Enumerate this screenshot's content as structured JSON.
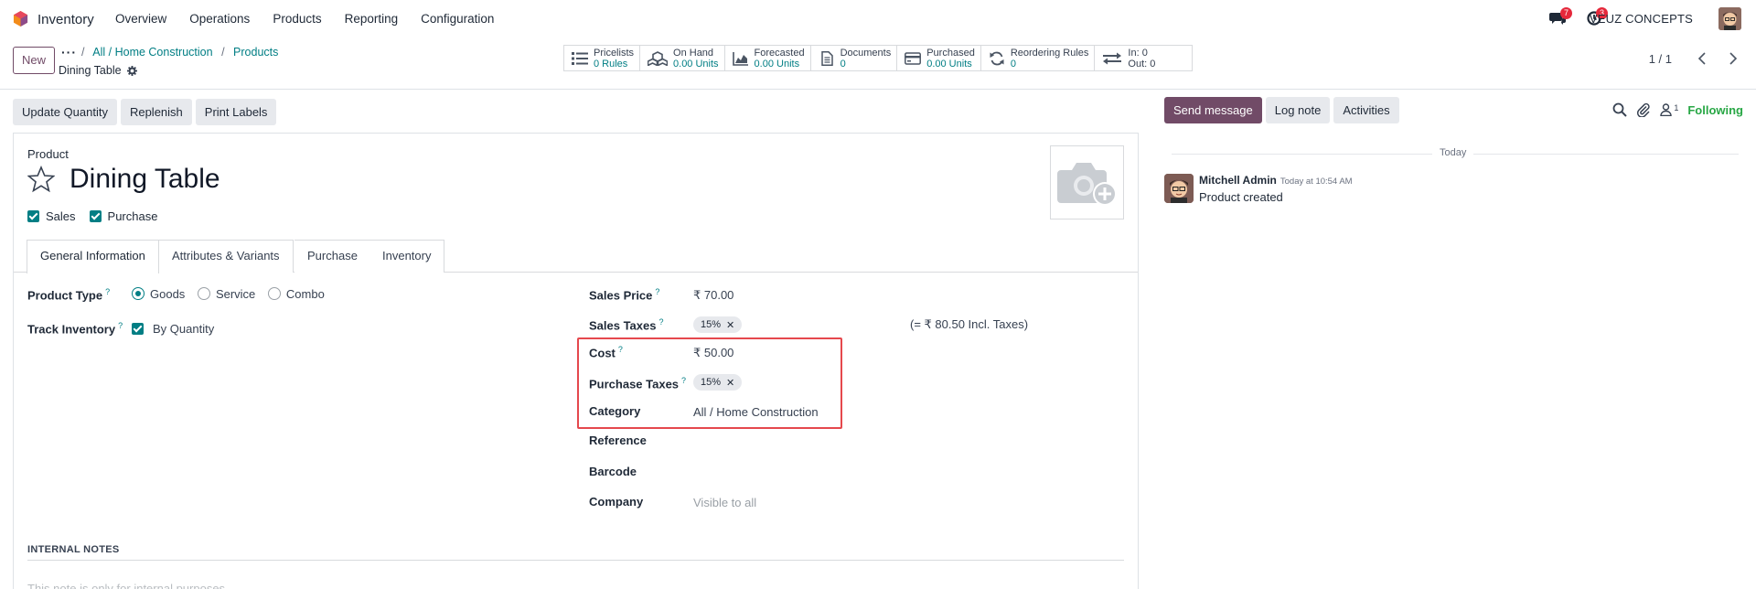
{
  "navbar": {
    "app_name": "Inventory",
    "menu": [
      "Overview",
      "Operations",
      "Products",
      "Reporting",
      "Configuration"
    ],
    "messages_badge": "7",
    "activities_badge": "3",
    "company": "VEUZ CONCEPTS",
    "colors": {
      "badge": "#e5283b",
      "accent": "#714b67",
      "link": "#017e84"
    }
  },
  "control_panel": {
    "new_label": "New",
    "breadcrumb": [
      "All / Home Construction",
      "Products"
    ],
    "record_name": "Dining Table",
    "smart_buttons": [
      {
        "icon": "list-icon",
        "label": "Pricelists",
        "value": "0 Rules"
      },
      {
        "icon": "cubes-icon",
        "label": "On Hand",
        "value": "0.00 Units"
      },
      {
        "icon": "area-chart-icon",
        "label": "Forecasted",
        "value": "0.00 Units"
      },
      {
        "icon": "document-icon",
        "label": "Documents",
        "value": "0"
      },
      {
        "icon": "credit-card-icon",
        "label": "Purchased",
        "value": "0.00 Units"
      },
      {
        "icon": "refresh-icon",
        "label": "Reordering Rules",
        "value": "0"
      },
      {
        "icon": "exchange-icon",
        "label": "In: 0",
        "value": "Out: 0"
      }
    ],
    "pager": "1 / 1"
  },
  "actions": [
    "Update Quantity",
    "Replenish",
    "Print Labels"
  ],
  "form": {
    "product_label": "Product",
    "name": "Dining Table",
    "sales_label": "Sales",
    "purchase_label": "Purchase",
    "tabs": [
      "General Information",
      "Attributes & Variants",
      "Purchase",
      "Inventory"
    ],
    "product_type": {
      "label": "Product Type",
      "options": [
        "Goods",
        "Service",
        "Combo"
      ],
      "selected": "Goods"
    },
    "track_inventory": {
      "label": "Track Inventory",
      "value": "By Quantity"
    },
    "sales_price": {
      "label": "Sales Price",
      "value": "₹ 70.00"
    },
    "sales_taxes": {
      "label": "Sales Taxes",
      "tag": "15%",
      "note": "(= ₹ 80.50 Incl. Taxes)"
    },
    "cost": {
      "label": "Cost",
      "value": "₹ 50.00"
    },
    "purchase_taxes": {
      "label": "Purchase Taxes",
      "tag": "15%"
    },
    "category": {
      "label": "Category",
      "value": "All / Home Construction"
    },
    "reference": {
      "label": "Reference",
      "value": ""
    },
    "barcode": {
      "label": "Barcode",
      "value": ""
    },
    "company": {
      "label": "Company",
      "placeholder": "Visible to all"
    },
    "internal_notes_title": "INTERNAL NOTES",
    "internal_notes_placeholder": "This note is only for internal purposes."
  },
  "chatter": {
    "send_message": "Send message",
    "log_note": "Log note",
    "activities": "Activities",
    "followers_count": "1",
    "following": "Following",
    "today": "Today",
    "message": {
      "author": "Mitchell Admin",
      "date": "Today at 10:54 AM",
      "body": "Product created"
    }
  }
}
